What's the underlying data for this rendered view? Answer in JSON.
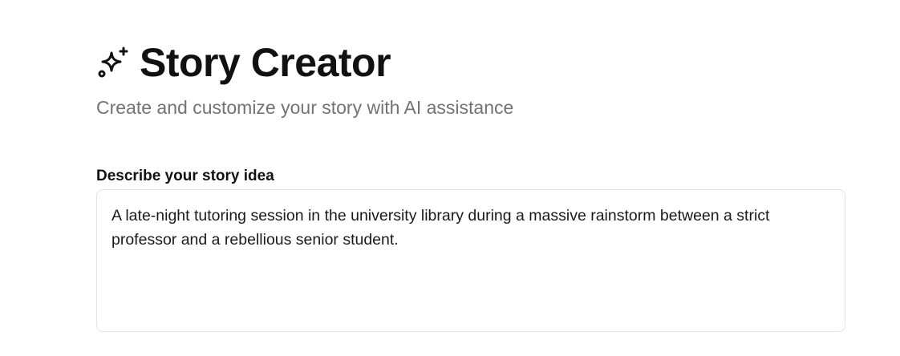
{
  "header": {
    "icon": "sparkles-icon",
    "title": "Story Creator",
    "subtitle": "Create and customize your story with AI assistance"
  },
  "story_form": {
    "idea_label": "Describe your story idea",
    "idea_value": "A late-night tutoring session in the university library during a massive rainstorm between a strict professor and a rebellious senior student."
  },
  "colors": {
    "title": "#111111",
    "subtitle": "#737373",
    "border": "#e3e3e3",
    "background": "#ffffff"
  }
}
